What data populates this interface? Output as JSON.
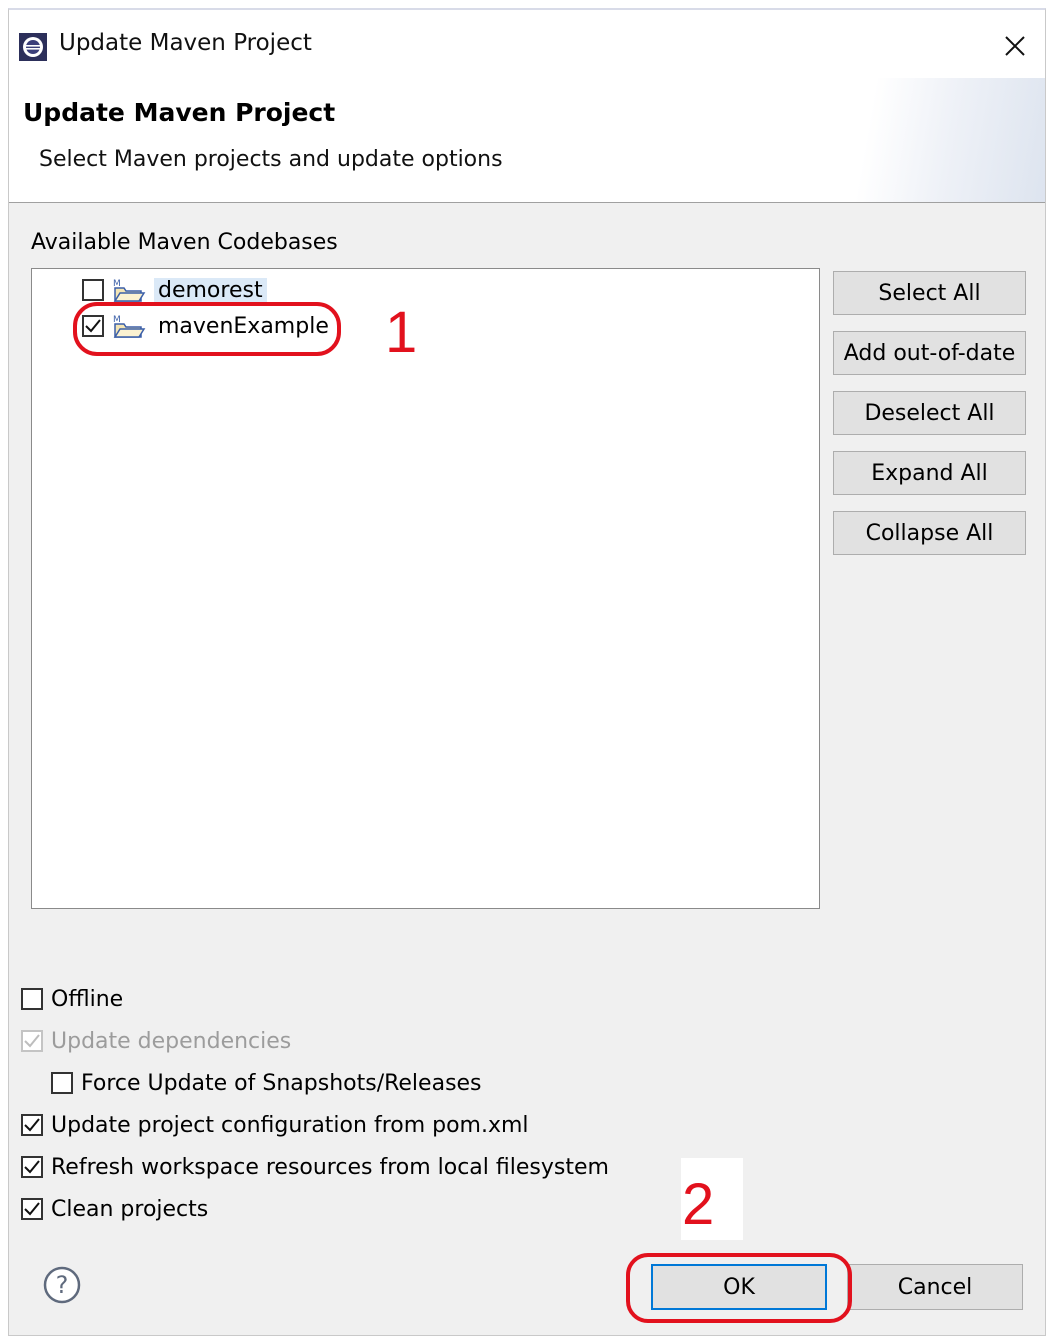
{
  "window": {
    "title": "Update Maven Project",
    "app_icon": "eclipse-icon",
    "close_icon": "close-icon"
  },
  "banner": {
    "title": "Update Maven Project",
    "subtitle": "Select Maven projects and update options"
  },
  "codebases": {
    "label": "Available Maven Codebases",
    "items": [
      {
        "label": "demorest",
        "checked": false,
        "selected": true,
        "icon": "maven-project-folder-icon"
      },
      {
        "label": "mavenExample",
        "checked": true,
        "selected": false,
        "icon": "maven-project-folder-icon"
      }
    ]
  },
  "side_buttons": {
    "select_all": "Select All",
    "add_out_of_date": "Add out-of-date",
    "deselect_all": "Deselect All",
    "expand_all": "Expand All",
    "collapse_all": "Collapse All"
  },
  "options": [
    {
      "label": "Offline",
      "checked": false,
      "enabled": true
    },
    {
      "label": "Update dependencies",
      "checked": true,
      "enabled": false
    },
    {
      "label": "Force Update of Snapshots/Releases",
      "checked": false,
      "enabled": true
    },
    {
      "label": "Update project configuration from pom.xml",
      "checked": true,
      "enabled": true
    },
    {
      "label": "Refresh workspace resources from local filesystem",
      "checked": true,
      "enabled": true
    },
    {
      "label": "Clean projects",
      "checked": true,
      "enabled": true
    }
  ],
  "footer": {
    "help_icon": "help-icon",
    "ok_label": "OK",
    "cancel_label": "Cancel"
  },
  "annotations": {
    "step1": "1",
    "step2": "2",
    "color": "#e2111d"
  }
}
